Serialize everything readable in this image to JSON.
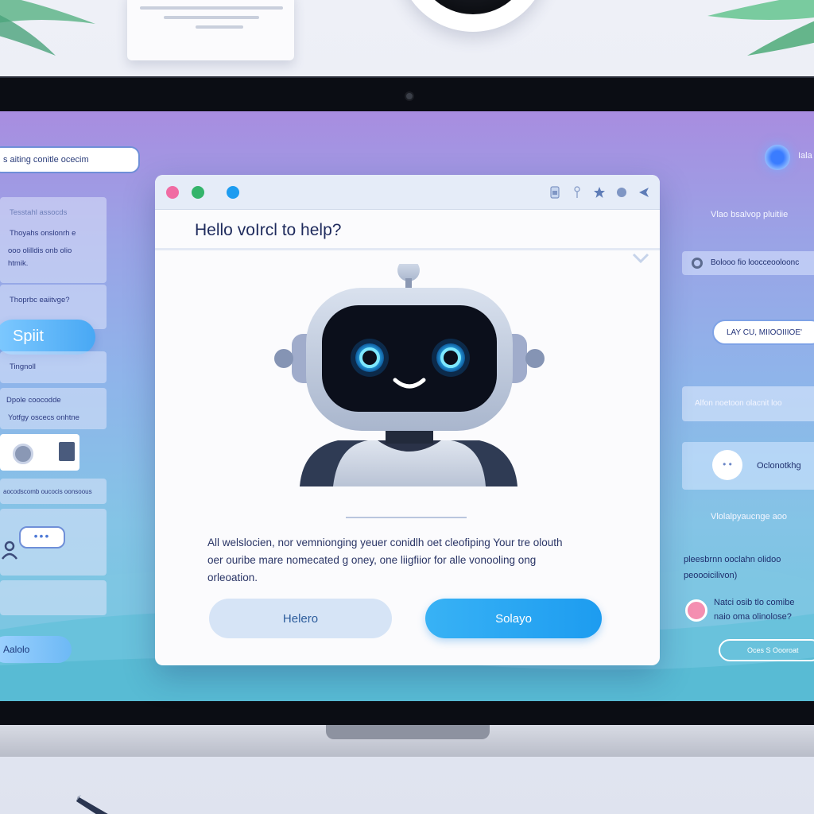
{
  "colors": {
    "accent": "#1d9cf0",
    "secondary_button": "#d6e4f6",
    "dot_pink": "#f06ba3",
    "dot_green": "#34b46b",
    "dot_blue": "#1d9cf0",
    "screen_top": "#a88de0",
    "screen_bottom": "#6fc7dc"
  },
  "left_panel": {
    "top_bubble": "s aiting conitle ocecim",
    "card1_lines": [
      "Tesstahl assocds",
      "Thoyahs onslonrh e",
      "ooo olilldis onb olio",
      "htmik."
    ],
    "card2_line": "Thoprbc eaiitvge?",
    "split_button": "Spiit",
    "card3_line": "Tingnoll",
    "card4_lines": [
      "Dpole coocodde",
      "Yotfgy oscecs onhtne"
    ],
    "card5_line": "aocodscomb oucocis oonsoous",
    "typing_dots": "•••",
    "bottom_pill": "Aalolo"
  },
  "right_panel": {
    "top_text": "Iala",
    "line1": "Vlao bsalvop pluitiie",
    "row_text": "Bolooo fio loocceooloonc",
    "pill": "LAY CU, MIIOOIIIOE'",
    "card_text": "Alfon noetoon olacnit loo",
    "card2_text": "Oclonotkhg",
    "line2": "Vlolalpyaucnge aoo",
    "line3": "pleesbrnn ooclahn olidoo",
    "line4": "peoooicilivon)",
    "pink_text": [
      "Natci osib tlo comibe",
      "naio oma olinolose?"
    ],
    "outline_button": "Oces S Oooroat"
  },
  "dialog": {
    "title": "Hello voIrcl to help?",
    "body": "All welslocien, nor  vemnionging yeuer conidlh oet cleofiping Your tre olouth oer ouribe mare nomecated g oney, one liigfiior for alle vonooling ong orleoation.",
    "button_secondary": "Helero",
    "button_primary": "Solayo",
    "titlebar_icons": [
      "doc-icon",
      "pin-icon",
      "star-icon",
      "circle-icon",
      "send-icon"
    ]
  }
}
